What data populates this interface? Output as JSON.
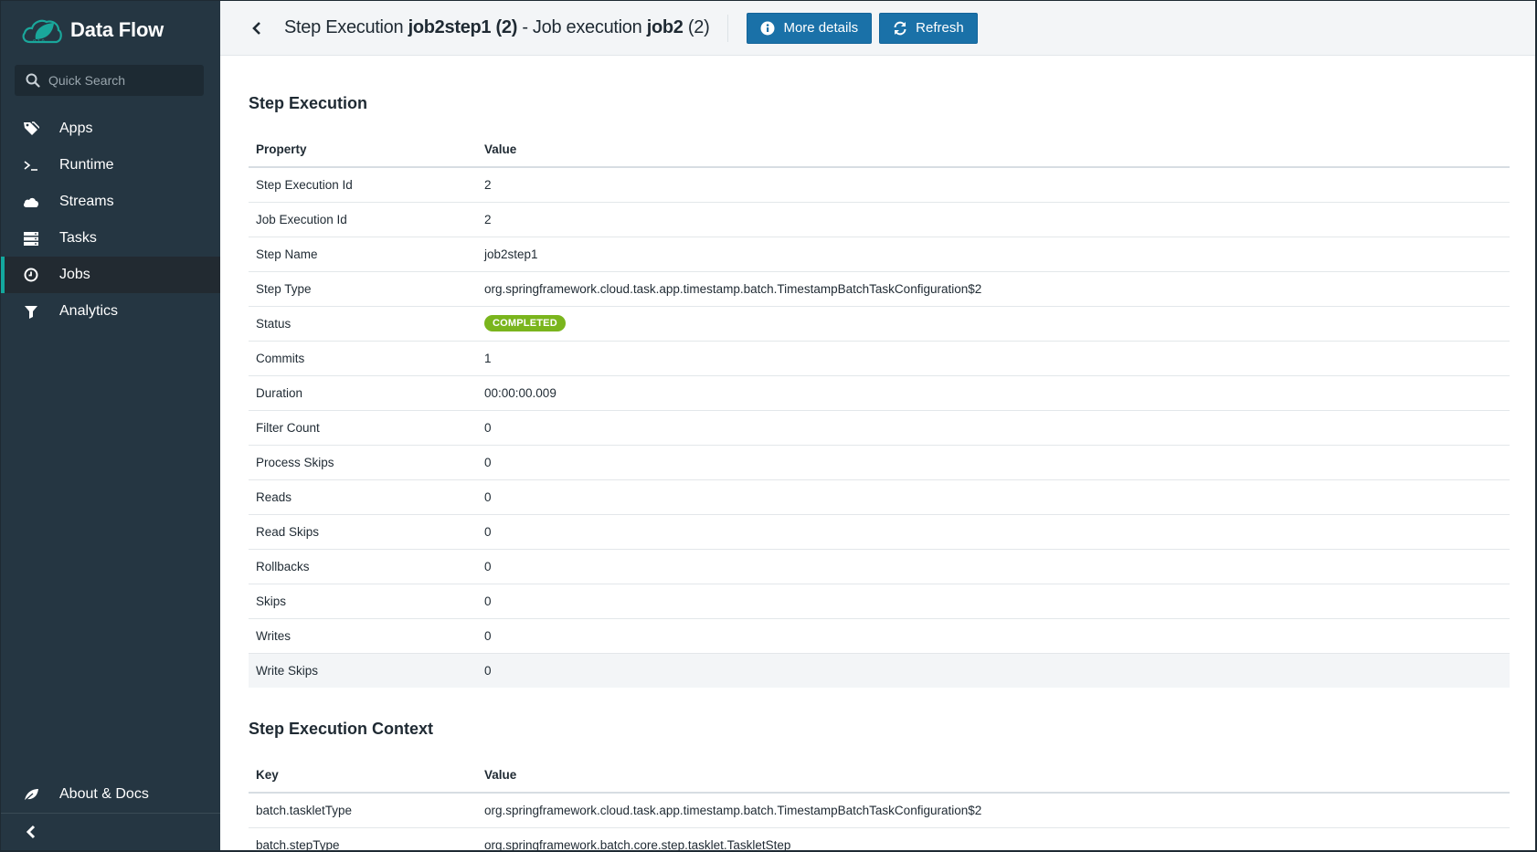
{
  "app": {
    "name": "Data Flow",
    "colors": {
      "sidebar_bg": "#253642",
      "active_accent": "#13a89e",
      "primary_button": "#1a71a8",
      "status_completed": "#7ab51d"
    }
  },
  "sidebar": {
    "search_placeholder": "Quick Search",
    "items": [
      {
        "label": "Apps",
        "icon": "tag-icon",
        "active": false
      },
      {
        "label": "Runtime",
        "icon": "terminal-icon",
        "active": false
      },
      {
        "label": "Streams",
        "icon": "cloud-icon",
        "active": false
      },
      {
        "label": "Tasks",
        "icon": "server-icon",
        "active": false
      },
      {
        "label": "Jobs",
        "icon": "clock-icon",
        "active": true
      },
      {
        "label": "Analytics",
        "icon": "filter-icon",
        "active": false
      }
    ],
    "about_label": "About & Docs",
    "collapse_icon": "chevron-left-icon"
  },
  "header": {
    "title_prefix": "Step Execution ",
    "step_name": "job2step1 (2)",
    "title_middle": " - Job execution ",
    "job_name": "job2",
    "job_suffix": " (2)",
    "buttons": {
      "more_details": "More details",
      "refresh": "Refresh"
    }
  },
  "step_execution": {
    "heading": "Step Execution",
    "columns": [
      "Property",
      "Value"
    ],
    "rows": [
      {
        "property": "Step Execution Id",
        "value": "2"
      },
      {
        "property": "Job Execution Id",
        "value": "2"
      },
      {
        "property": "Step Name",
        "value": "job2step1"
      },
      {
        "property": "Step Type",
        "value": "org.springframework.cloud.task.app.timestamp.batch.TimestampBatchTaskConfiguration$2"
      },
      {
        "property": "Status",
        "value": "COMPLETED"
      },
      {
        "property": "Commits",
        "value": "1"
      },
      {
        "property": "Duration",
        "value": "00:00:00.009"
      },
      {
        "property": "Filter Count",
        "value": "0"
      },
      {
        "property": "Process Skips",
        "value": "0"
      },
      {
        "property": "Reads",
        "value": "0"
      },
      {
        "property": "Read Skips",
        "value": "0"
      },
      {
        "property": "Rollbacks",
        "value": "0"
      },
      {
        "property": "Skips",
        "value": "0"
      },
      {
        "property": "Writes",
        "value": "0"
      },
      {
        "property": "Write Skips",
        "value": "0"
      }
    ]
  },
  "step_execution_context": {
    "heading": "Step Execution Context",
    "columns": [
      "Key",
      "Value"
    ],
    "rows": [
      {
        "key": "batch.taskletType",
        "value": "org.springframework.cloud.task.app.timestamp.batch.TimestampBatchTaskConfiguration$2"
      },
      {
        "key": "batch.stepType",
        "value": "org.springframework.batch.core.step.tasklet.TaskletStep"
      }
    ]
  }
}
